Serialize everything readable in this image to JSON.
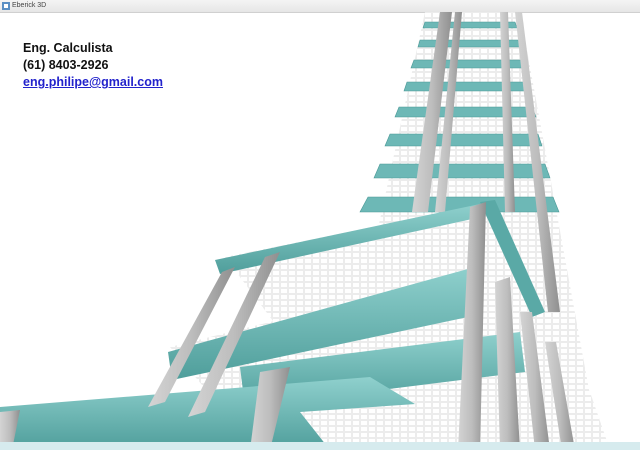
{
  "window": {
    "title": "Eberick 3D"
  },
  "overlay": {
    "role": "Eng. Calculista",
    "phone": "(61) 8403-2926",
    "email": "eng.philipe@gmail.com"
  },
  "colors": {
    "beam": "#6db8b6",
    "beam_dark": "#4a9896",
    "column": "#b6b6b6",
    "column_dark": "#8e8e8e",
    "slab_grid": "#d9d9d9",
    "background": "#ffffff"
  }
}
